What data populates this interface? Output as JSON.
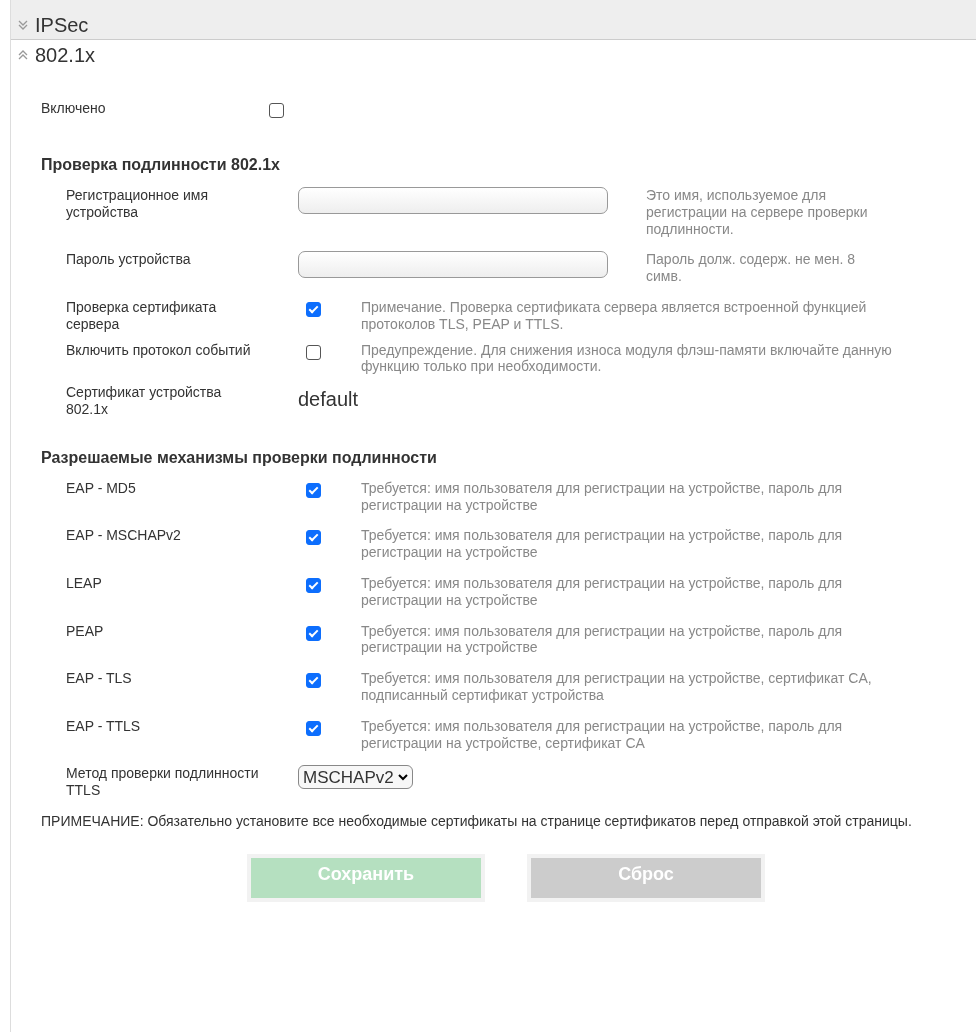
{
  "sections": [
    {
      "title": "IPSec",
      "expanded": false
    },
    {
      "title": "802.1x",
      "expanded": true
    }
  ],
  "enabled": {
    "label": "Включено",
    "checked": false
  },
  "auth": {
    "heading": "Проверка подлинности 802.1x",
    "rows": [
      {
        "kind": "text",
        "label": "Регистрационное имя устройства",
        "hint": "Это имя, используемое для регистрации на сервере проверки подлинности."
      },
      {
        "kind": "text",
        "label": "Пароль устройства",
        "hint": "Пароль долж. содерж. не мен. 8 симв."
      },
      {
        "kind": "check",
        "label": "Проверка сертификата сервера",
        "checked": true,
        "hint": "Примечание. Проверка сертификата сервера является встроенной функцией протоколов TLS, PEAP и TTLS."
      },
      {
        "kind": "check",
        "label": "Включить протокол событий",
        "checked": false,
        "hint": "Предупреждение. Для снижения износа модуля флэш-памяти включайте данную функцию только при необходимости."
      },
      {
        "kind": "value",
        "label": "Сертификат устройства 802.1x",
        "value": "default"
      }
    ]
  },
  "methods": {
    "heading": "Разрешаемые механизмы проверки подлинности",
    "rows": [
      {
        "label": "EAP - MD5",
        "checked": true,
        "hint": "Требуется: имя пользователя для регистрации на устройстве, пароль для регистрации на устройстве"
      },
      {
        "label": "EAP - MSCHAPv2",
        "checked": true,
        "hint": "Требуется: имя пользователя для регистрации на устройстве, пароль для регистрации на устройстве"
      },
      {
        "label": "LEAP",
        "checked": true,
        "hint": "Требуется: имя пользователя для регистрации на устройстве, пароль для регистрации на устройстве"
      },
      {
        "label": "PEAP",
        "checked": true,
        "hint": "Требуется: имя пользователя для регистрации на устройстве, пароль для регистрации на устройстве"
      },
      {
        "label": "EAP - TLS",
        "checked": true,
        "hint": "Требуется: имя пользователя для регистрации на устройстве, сертификат CA, подписанный сертификат устройства"
      },
      {
        "label": "EAP - TTLS",
        "checked": true,
        "hint": "Требуется: имя пользователя для регистрации на устройстве, пароль для регистрации на устройстве, сертификат CA"
      }
    ],
    "ttls": {
      "label": "Метод проверки подлинности TTLS",
      "value": "MSCHAPv2"
    }
  },
  "note": "ПРИМЕЧАНИЕ: Обязательно установите все необходимые сертификаты на странице сертификатов перед отправкой этой страницы.",
  "buttons": [
    {
      "label": "Сохранить",
      "kind": "save"
    },
    {
      "label": "Сброс",
      "kind": "reset"
    }
  ]
}
